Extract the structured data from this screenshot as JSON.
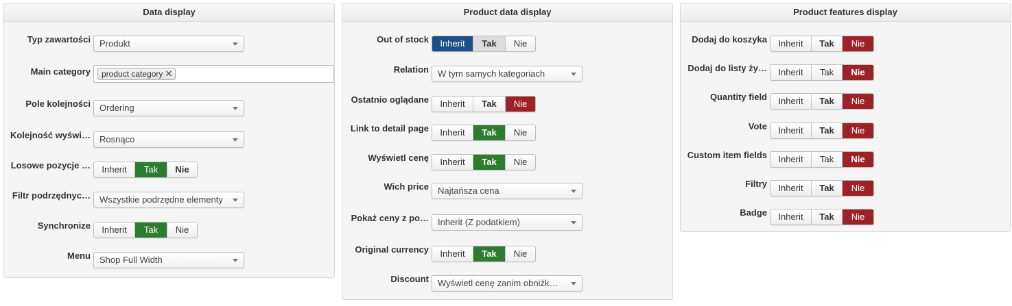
{
  "colors": {
    "inherit_active": "#1a4f88",
    "tak_active": "#2e7b32",
    "nie_active": "#9d2227",
    "panel_bg": "#f5f5f5"
  },
  "panels": {
    "data_display": {
      "title": "Data display",
      "content_type": {
        "label": "Typ zawartości",
        "value": "Produkt"
      },
      "main_category": {
        "label": "Main category",
        "tag": "product category"
      },
      "order_field": {
        "label": "Pole kolejności",
        "value": "Ordering"
      },
      "display_order": {
        "label": "Kolejność wyświ…",
        "value": "Rosnąco"
      },
      "random_items": {
        "label": "Losowe pozycje …",
        "inherit": "Inherit",
        "tak": "Tak",
        "nie": "Nie",
        "selected": "Tak"
      },
      "child_filter": {
        "label": "Filtr podrzędnyc…",
        "value": "Wszystkie podrzędne elementy"
      },
      "synchronize": {
        "label": "Synchronize",
        "inherit": "Inherit",
        "tak": "Tak",
        "nie": "Nie",
        "selected": "Tak"
      },
      "menu": {
        "label": "Menu",
        "value": "Shop Full Width"
      }
    },
    "product_data_display": {
      "title": "Product data display",
      "out_of_stock": {
        "label": "Out of stock",
        "inherit": "Inherit",
        "tak": "Tak",
        "nie": "Nie",
        "selected": "Inherit"
      },
      "relation": {
        "label": "Relation",
        "value": "W tym samych kategoriach"
      },
      "recently_viewed": {
        "label": "Ostatnio oglądane",
        "inherit": "Inherit",
        "tak": "Tak",
        "nie": "Nie",
        "selected": "Nie"
      },
      "detail_link": {
        "label": "Link to detail page",
        "inherit": "Inherit",
        "tak": "Tak",
        "nie": "Nie",
        "selected": "Tak"
      },
      "show_price": {
        "label": "Wyświetl cenę",
        "inherit": "Inherit",
        "tak": "Tak",
        "nie": "Nie",
        "selected": "Tak"
      },
      "which_price": {
        "label": "Wich price",
        "value": "Najtańsza cena"
      },
      "price_tax": {
        "label": "Pokaż ceny z po…",
        "value": "Inherit (Z podatkiem)"
      },
      "original_currency": {
        "label": "Original currency",
        "inherit": "Inherit",
        "tak": "Tak",
        "nie": "Nie",
        "selected": "Tak"
      },
      "discount": {
        "label": "Discount",
        "value": "Wyświetl cenę zanim obniżk…"
      }
    },
    "product_features_display": {
      "title": "Product features display",
      "add_to_cart": {
        "label": "Dodaj do koszyka",
        "inherit": "Inherit",
        "tak": "Tak",
        "nie": "Nie",
        "selected": "Nie"
      },
      "add_to_wishlist": {
        "label": "Dodaj do listy ży…",
        "inherit": "Inherit",
        "tak": "Tak",
        "nie": "Nie",
        "selected": "Nie"
      },
      "quantity_field": {
        "label": "Quantity field",
        "inherit": "Inherit",
        "tak": "Tak",
        "nie": "Nie",
        "selected": "Nie"
      },
      "vote": {
        "label": "Vote",
        "inherit": "Inherit",
        "tak": "Tak",
        "nie": "Nie",
        "selected": "Nie"
      },
      "custom_item_fields": {
        "label": "Custom item fields",
        "inherit": "Inherit",
        "tak": "Tak",
        "nie": "Nie",
        "selected": "Nie"
      },
      "filters": {
        "label": "Filtry",
        "inherit": "Inherit",
        "tak": "Tak",
        "nie": "Nie",
        "selected": "Nie"
      },
      "badge": {
        "label": "Badge",
        "inherit": "Inherit",
        "tak": "Tak",
        "nie": "Nie",
        "selected": "Nie"
      }
    }
  }
}
